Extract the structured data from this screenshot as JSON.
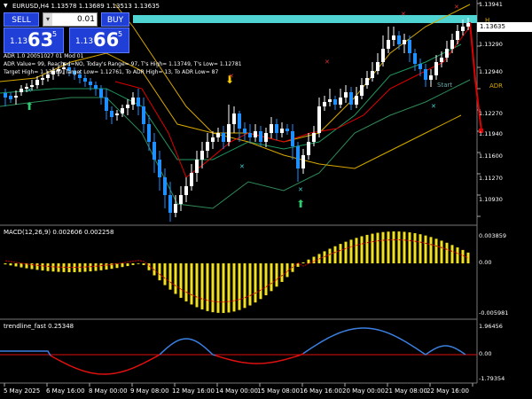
{
  "header": {
    "symbol_title": "EURUSD,H4 1.13578 1.13689 1.13513 1.13635",
    "symbol_icon": "dropdown-triangle-icon"
  },
  "trade_panel": {
    "sell_label": "SELL",
    "buy_label": "BUY",
    "lot_value": "0.01",
    "lot_arrow": "▾",
    "sell_price": {
      "prefix": "1.13",
      "big": "63",
      "sup": "5"
    },
    "buy_price": {
      "prefix": "1.13",
      "big": "66",
      "sup": "5"
    }
  },
  "info": {
    "line1": "ADR 1.0 20051027 01 Mod 01",
    "line2": "ADR Value= 99, Reached=NO, Today's Range= 97, T's High= 1.13749, T's Low= 1.12781",
    "line3": "Target High= 1.13769, Target Low= 1.12761, To ADR High= 13, To ADR Low= 87"
  },
  "chart_labels": {
    "adr_right": "ADR",
    "adr_top": "H",
    "start": "Start"
  },
  "price_axis": {
    "labels": [
      "1.13941",
      "1.13635",
      "1.13290",
      "1.12940",
      "1.12270",
      "1.11940",
      "1.11600",
      "1.11270",
      "1.10930"
    ],
    "current_bid": "1.13635"
  },
  "macd": {
    "label": "MACD(12,26,9) 0.002606 0.002258",
    "axis": [
      "0.003859",
      "0.00",
      "-0.005981"
    ]
  },
  "trendline": {
    "label": "trendline_fast 0.25348",
    "axis": [
      "1.96456",
      "0.00",
      "-1.79354"
    ]
  },
  "time_axis": [
    "5 May 2025",
    "6 May 16:00",
    "8 May 00:00",
    "9 May 08:00",
    "12 May 16:00",
    "14 May 00:00",
    "15 May 08:00",
    "16 May 16:00",
    "20 May 00:00",
    "21 May 08:00",
    "22 May 16:00"
  ],
  "colors": {
    "background": "#000000",
    "bull_candle": "#ffffff",
    "bear_candle": "#1e90ff",
    "bid_line": "#4fd3d3",
    "macd_bars": "#f0e020",
    "macd_signal": "#cc0000",
    "trend_up": "#3b7fe0",
    "trend_down": "#e01010",
    "adr_line": "#d8a800",
    "panel_blue": "#1f3fd6"
  }
}
